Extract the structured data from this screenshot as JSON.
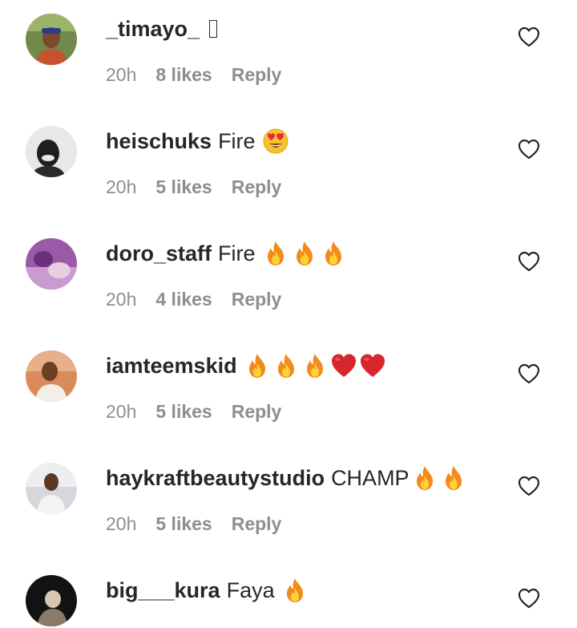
{
  "colors": {
    "text": "#262626",
    "meta": "#8e8e8e",
    "background": "#ffffff",
    "fire": "#f7a21b",
    "heart_red": "#d7262e"
  },
  "comments": [
    {
      "username": "_timayo_",
      "text": "",
      "emojis": [],
      "time": "20h",
      "likes": "8 likes",
      "reply": "Reply",
      "avatar_icon": "avatar-photo-icon"
    },
    {
      "username": "heischuks",
      "text": "Fire",
      "emojis": [
        "heart-eyes-emoji"
      ],
      "time": "20h",
      "likes": "5 likes",
      "reply": "Reply",
      "avatar_icon": "avatar-photo-icon"
    },
    {
      "username": "doro_staff",
      "text": "Fire",
      "emojis": [
        "fire-emoji",
        "fire-emoji",
        "fire-emoji"
      ],
      "time": "20h",
      "likes": "4 likes",
      "reply": "Reply",
      "avatar_icon": "avatar-photo-icon"
    },
    {
      "username": "iamteemskid",
      "text": "",
      "emojis": [
        "fire-emoji",
        "fire-emoji",
        "fire-emoji",
        "red-heart-emoji",
        "red-heart-emoji"
      ],
      "time": "20h",
      "likes": "5 likes",
      "reply": "Reply",
      "avatar_icon": "avatar-photo-icon"
    },
    {
      "username": "haykraftbeautystudio",
      "text": "CHAMP",
      "emojis": [
        "fire-emoji",
        "fire-emoji"
      ],
      "time": "20h",
      "likes": "5 likes",
      "reply": "Reply",
      "avatar_icon": "avatar-photo-icon"
    },
    {
      "username": "big___kura",
      "text": "Faya",
      "emojis": [
        "fire-emoji"
      ],
      "time": "",
      "likes": "",
      "reply": "",
      "avatar_icon": "avatar-photo-icon"
    }
  ]
}
